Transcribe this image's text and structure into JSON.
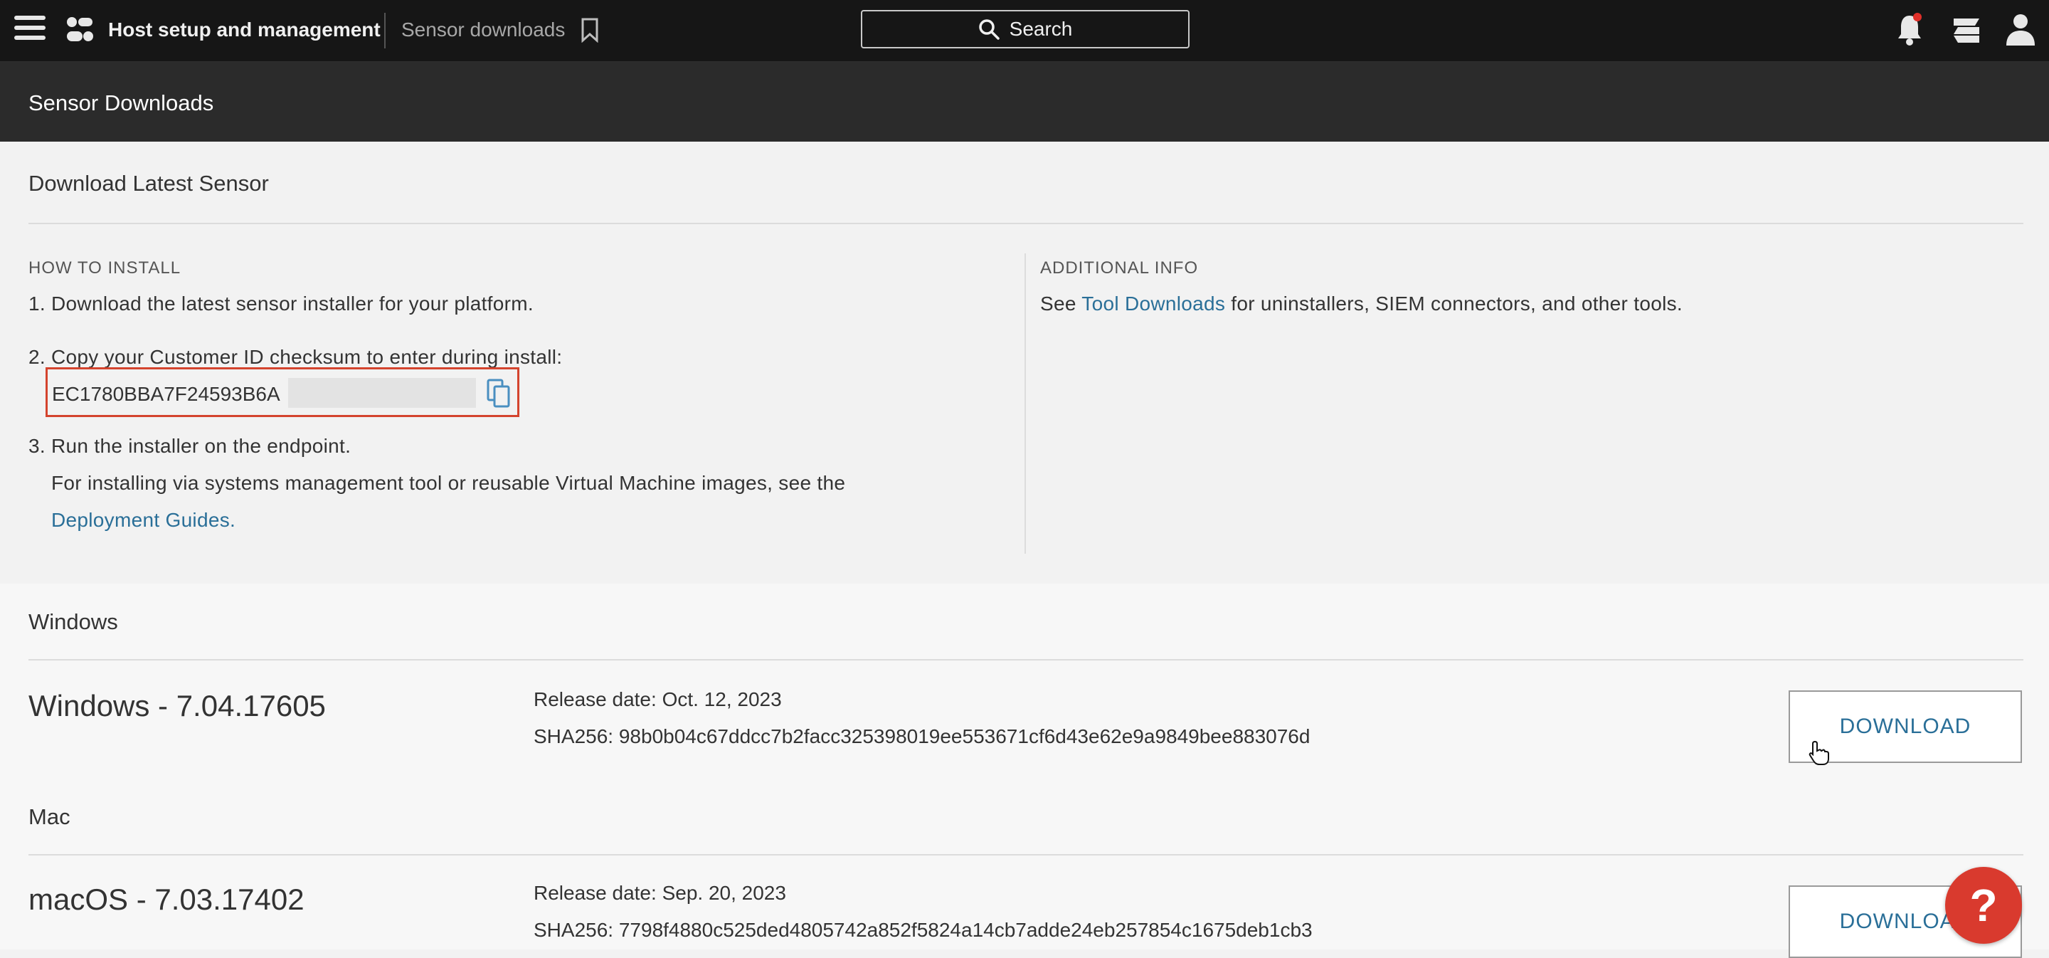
{
  "nav": {
    "app_title": "Host setup and management",
    "breadcrumb": "Sensor downloads",
    "search_label": "Search"
  },
  "page": {
    "title": "Sensor Downloads"
  },
  "download_latest": {
    "heading": "Download Latest Sensor",
    "how_to_install": {
      "label": "HOW TO INSTALL",
      "step1": "1. Download the latest sensor installer for your platform.",
      "step2": "2. Copy your Customer ID checksum to enter during install:",
      "customer_id": "EC1780BBA7F24593B6A",
      "step3": "3. Run the installer on the endpoint.",
      "step3_detail": "For installing via systems management tool or reusable Virtual Machine images, see the",
      "deployment_link": "Deployment Guides",
      "deployment_suffix": "."
    },
    "additional_info": {
      "label": "ADDITIONAL INFO",
      "prefix": "See ",
      "link": "Tool Downloads",
      "suffix": " for uninstallers, SIEM connectors, and other tools."
    }
  },
  "sensors": [
    {
      "platform": "Windows",
      "name": "Windows - 7.04.17605",
      "release": "Release date: Oct. 12, 2023",
      "sha": "SHA256: 98b0b04c67ddcc7b2facc325398019ee553671cf6d43e62e9a9849bee883076d",
      "button": "DOWNLOAD"
    },
    {
      "platform": "Mac",
      "name": "macOS - 7.03.17402",
      "release": "Release date: Sep. 20, 2023",
      "sha": "SHA256: 7798f4880c525ded4805742a852f5824a14cb7adde24eb257854c1675deb1cb3",
      "button": "DOWNLOAD"
    }
  ],
  "help": {
    "label": "?"
  },
  "colors": {
    "accent_link": "#2a6f98",
    "highlight_border": "#d4442e",
    "help_button": "#d93a2e"
  },
  "icons": [
    "menu-icon",
    "logo-icon",
    "bookmark-icon",
    "search-icon",
    "bell-icon",
    "apps-icon",
    "user-icon",
    "copy-icon",
    "pointer-cursor-icon"
  ]
}
